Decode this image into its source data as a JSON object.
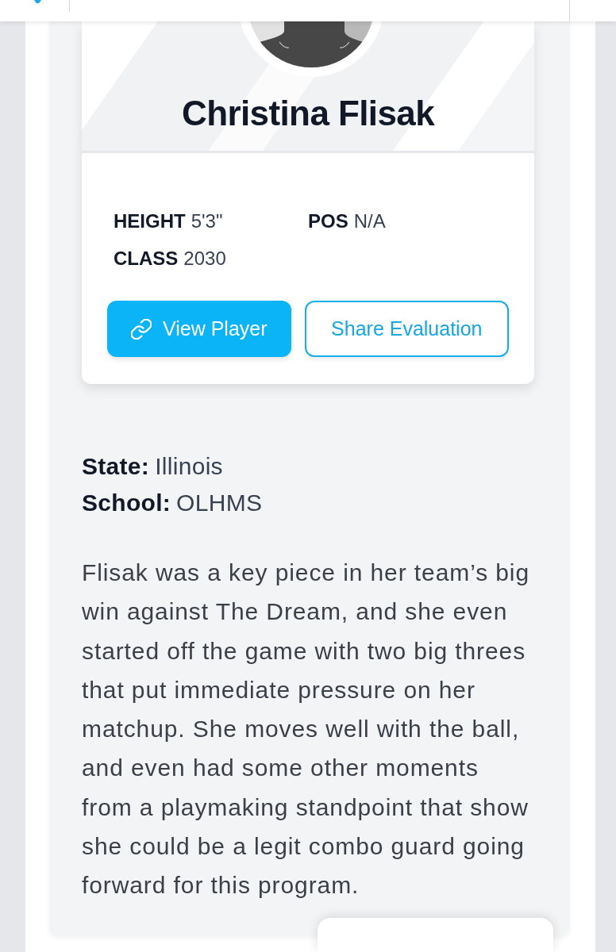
{
  "player": {
    "name": "Christina Flisak",
    "stats": [
      {
        "label": "HEIGHT",
        "value": "5'3\""
      },
      {
        "label": "POS",
        "value": "N/A"
      },
      {
        "label": "CLASS",
        "value": "2030"
      }
    ],
    "buttons": [
      {
        "label": "View Player",
        "kind": "primary"
      },
      {
        "label": "Share Evaluation",
        "kind": "outline"
      }
    ]
  },
  "details": [
    {
      "label": "State:",
      "value": "Illinois"
    },
    {
      "label": "School:",
      "value": "OLHMS"
    }
  ],
  "evaluation": "Flisak was a key piece in her team’s big win against The Dream, and she even started off the game with two big threes that put immediate pressure on her matchup. She moves well with the ball, and even had some other moments from a playmaking standpoint that show she could be a legit combo guard going forward for this program."
}
